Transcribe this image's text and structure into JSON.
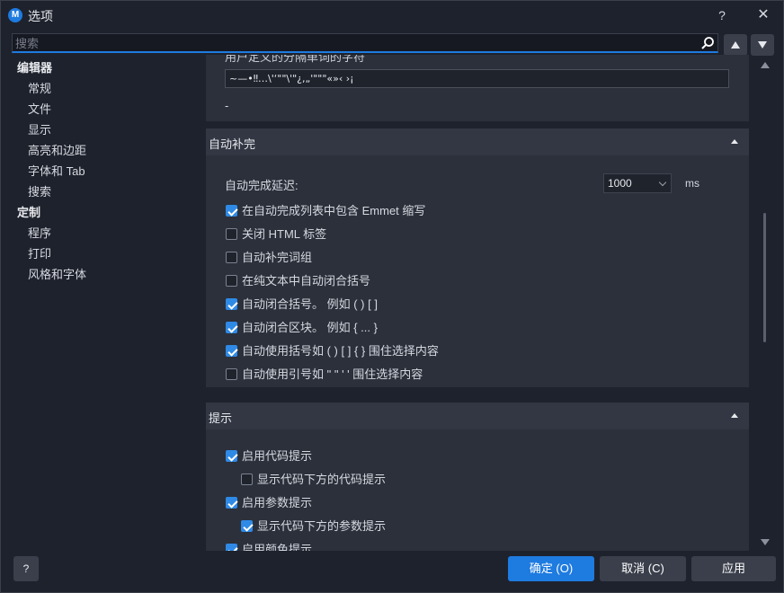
{
  "window": {
    "app_icon_letter": "M",
    "title": "选项",
    "help_label": "?",
    "close_label": "✕"
  },
  "search": {
    "placeholder": "搜索",
    "value": ""
  },
  "sidebar": {
    "groups": [
      {
        "label": "编辑器",
        "items": [
          "常规",
          "文件",
          "显示",
          "高亮和边距",
          "字体和 Tab",
          "搜索"
        ]
      },
      {
        "label": "定制",
        "items": [
          "程序",
          "打印",
          "风格和字体"
        ]
      }
    ]
  },
  "sections": {
    "top_partial": {
      "label_cut": "用户定义的分隔单词的字符",
      "chars_value": "~—•‼…\\'‘\"\"\\'\"¿,„'\"\"\"«»‹ ›¡",
      "extra_value": "-"
    },
    "autocomplete": {
      "title": "自动补完",
      "delay_label": "自动完成延迟:",
      "delay_value": "1000",
      "delay_unit": "ms",
      "options": [
        {
          "label": "在自动完成列表中包含 Emmet 缩写",
          "checked": true
        },
        {
          "label": "关闭 HTML 标签",
          "checked": false
        },
        {
          "label": "自动补完词组",
          "checked": false
        },
        {
          "label": "在纯文本中自动闭合括号",
          "checked": false
        },
        {
          "label": "自动闭合括号。 例如 ( ) [ ]",
          "checked": true
        },
        {
          "label": "自动闭合区块。 例如 { ... }",
          "checked": true
        },
        {
          "label": "自动使用括号如 ( ) [ ] { } 围住选择内容",
          "checked": true
        },
        {
          "label": "自动使用引号如 \" \" ' ' 围住选择内容",
          "checked": false
        }
      ]
    },
    "hints": {
      "title": "提示",
      "options": [
        {
          "label": "启用代码提示",
          "checked": true
        },
        {
          "label": "显示代码下方的代码提示",
          "checked": false
        },
        {
          "label": "启用参数提示",
          "checked": true
        },
        {
          "label": "显示代码下方的参数提示",
          "checked": true
        },
        {
          "label": "启用颜色提示",
          "checked": true
        }
      ]
    }
  },
  "footer": {
    "help_label": "?",
    "ok_label": "确定 (O)",
    "cancel_label": "取消 (C)",
    "apply_label": "应用"
  },
  "colors": {
    "accent": "#1e7be0",
    "background": "#1e222d",
    "panel": "#2b303b",
    "panel_header": "#323743"
  }
}
